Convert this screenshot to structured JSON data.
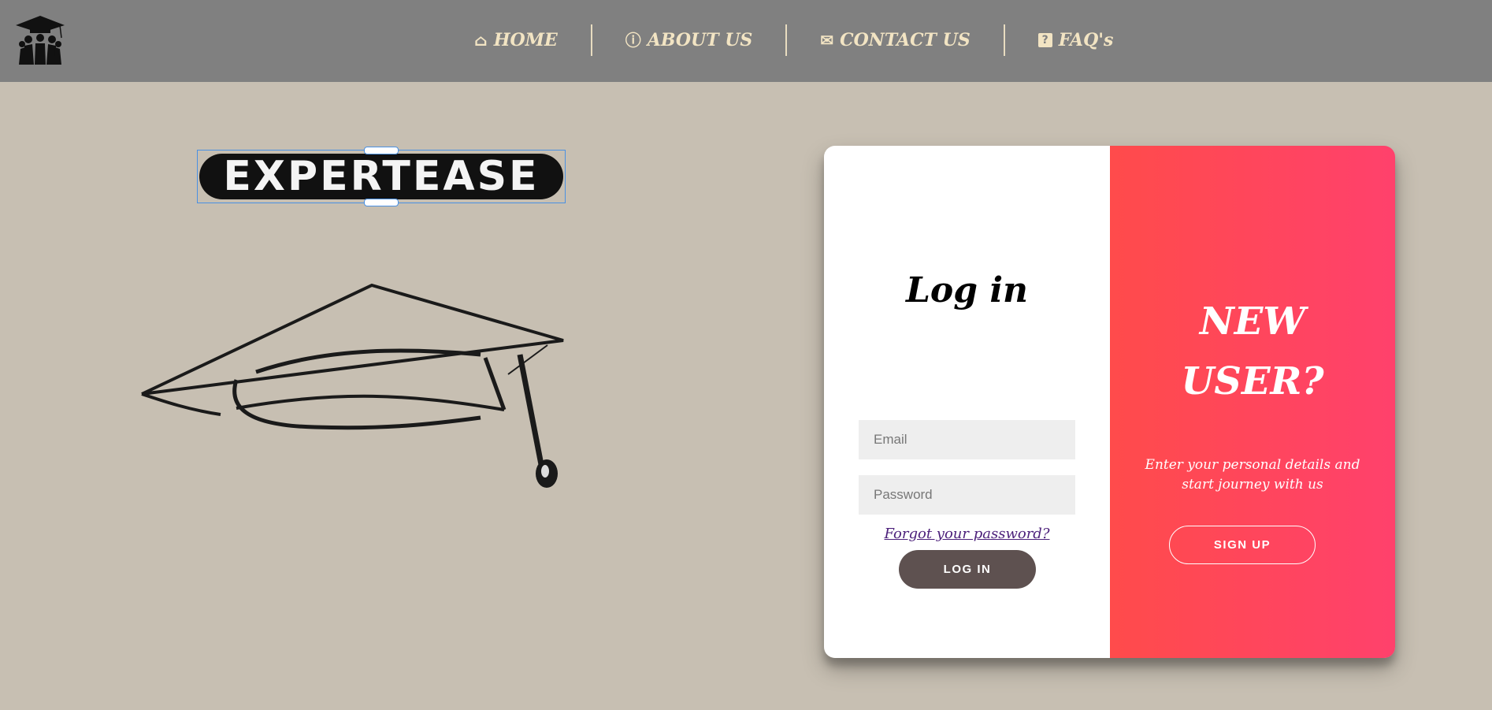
{
  "nav": {
    "items": [
      {
        "label": "HOME",
        "icon": "home-icon"
      },
      {
        "label": "ABOUT US",
        "icon": "info-icon"
      },
      {
        "label": "CONTACT US",
        "icon": "envelope-icon"
      },
      {
        "label": "FAQ's",
        "icon": "question-icon"
      }
    ]
  },
  "brand": {
    "name": "EXPERTEASE"
  },
  "login": {
    "title": "Log in",
    "email_placeholder": "Email",
    "password_placeholder": "Password",
    "forgot_label": "Forgot your password?",
    "button_label": "LOG IN"
  },
  "signup": {
    "title_line1": "NEW",
    "title_line2": "USER?",
    "text": "Enter your personal details and start journey with us",
    "button_label": "SIGN UP"
  },
  "colors": {
    "background": "#c7bfb2",
    "topbar": "#808080",
    "nav_text": "#f2e4c3",
    "accent_start": "#ff4b4b",
    "accent_end": "#ff416c",
    "login_button": "#5e5150"
  }
}
